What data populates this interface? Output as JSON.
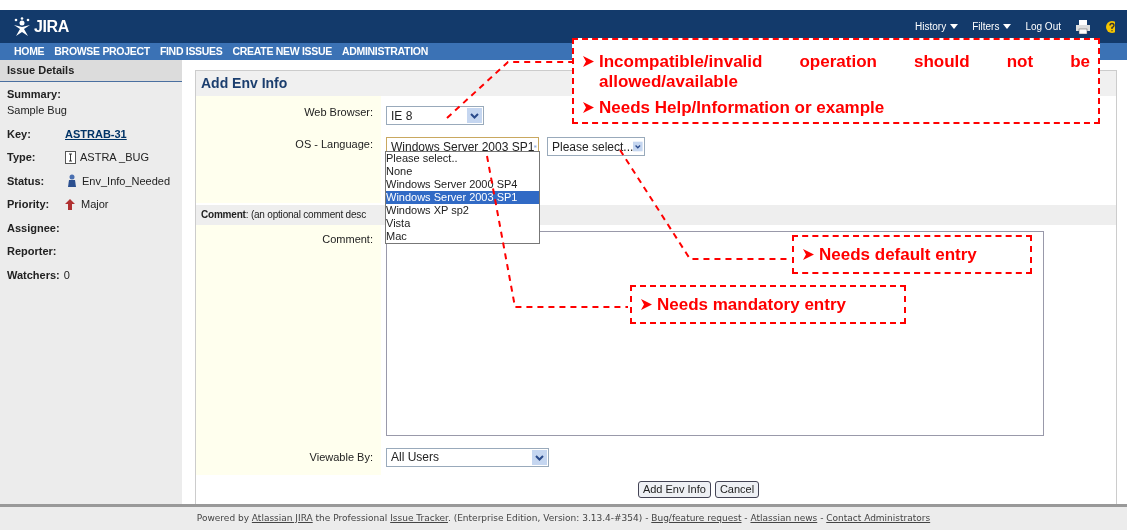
{
  "header": {
    "logo": "JIRA",
    "links": [
      {
        "label": "History",
        "dropdown": true
      },
      {
        "label": "Filters",
        "dropdown": true
      },
      {
        "label": "Log Out",
        "dropdown": false
      }
    ]
  },
  "nav": [
    "HOME",
    "BROWSE PROJECT",
    "FIND ISSUES",
    "CREATE NEW ISSUE",
    "ADMINISTRATION"
  ],
  "sidebar": {
    "title": "Issue Details",
    "summary": {
      "label": "Summary:",
      "value": "Sample Bug"
    },
    "fields": [
      {
        "label": "Key:",
        "value": "ASTRAB-31",
        "kind": "link"
      },
      {
        "label": "Type:",
        "value": "ASTRA _BUG",
        "kind": "type"
      },
      {
        "label": "Status:",
        "value": "Env_Info_Needed",
        "kind": "status"
      },
      {
        "label": "Priority:",
        "value": "Major",
        "kind": "priority"
      },
      {
        "label": "Assignee:",
        "kind": "empty"
      },
      {
        "label": "Reporter:",
        "kind": "empty"
      },
      {
        "label": "Watchers:",
        "value": "0",
        "kind": "text"
      }
    ]
  },
  "form": {
    "title": "Add Env Info",
    "web_browser": {
      "label": "Web Browser:",
      "value": "IE 8"
    },
    "os_language": {
      "label": "OS - Language:",
      "value": "Windows Server 2003 SP1",
      "language": "Please select..."
    },
    "comment_header": "**Comment**: (an optional comment desc",
    "comment": {
      "label": "Comment:"
    },
    "viewable_by": {
      "label": "Viewable By:",
      "value": "All Users"
    },
    "buttons": [
      "Add Env Info",
      "Cancel"
    ]
  },
  "os_dropdown": [
    {
      "label": "Please select..",
      "selected": false
    },
    {
      "label": "None",
      "selected": false
    },
    {
      "label": "Windows Server 2000 SP4",
      "selected": false
    },
    {
      "label": "Windows Server 2003 SP1",
      "selected": true
    },
    {
      "label": "Windows XP sp2",
      "selected": false
    },
    {
      "label": "Vista",
      "selected": false
    },
    {
      "label": "Mac",
      "selected": false
    }
  ],
  "callouts": [
    {
      "items": [
        "Incompatible/invalid operation should not be allowed/available",
        "Needs Help/Information or example"
      ]
    },
    {
      "items": [
        "Needs default entry"
      ]
    },
    {
      "items": [
        "Needs mandatory entry"
      ]
    }
  ],
  "footer": [
    {
      "text": "Powered by ",
      "kind": "text"
    },
    {
      "text": "Atlassian JIRA",
      "kind": "link"
    },
    {
      "text": " the Professional ",
      "kind": "text"
    },
    {
      "text": "Issue Tracker",
      "kind": "link"
    },
    {
      "text": ". (Enterprise Edition, Version: 3.13.4-#354) - ",
      "kind": "text"
    },
    {
      "text": "Bug/feature request",
      "kind": "link"
    },
    {
      "text": " - ",
      "kind": "text"
    },
    {
      "text": "Atlassian news",
      "kind": "link"
    },
    {
      "text": " - ",
      "kind": "text"
    },
    {
      "text": "Contact Administrators",
      "kind": "link"
    }
  ]
}
